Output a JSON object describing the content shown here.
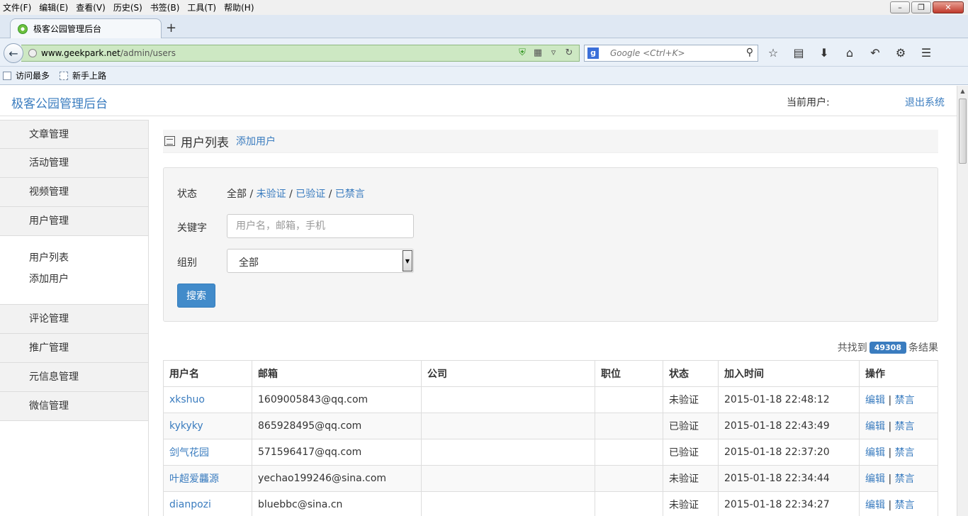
{
  "browser": {
    "menu": [
      "文件(F)",
      "编辑(E)",
      "查看(V)",
      "历史(S)",
      "书签(B)",
      "工具(T)",
      "帮助(H)"
    ],
    "tab_title": "极客公园管理后台",
    "url_domain": "www.geekpark.net",
    "url_path": "/admin/users",
    "search_placeholder": "Google <Ctrl+K>",
    "bookmarks": [
      "访问最多",
      "新手上路"
    ]
  },
  "header": {
    "brand": "极客公园管理后台",
    "current_user_label": "当前用户:",
    "logout": "退出系统"
  },
  "sidebar": {
    "groups_top": [
      "文章管理",
      "活动管理",
      "视频管理",
      "用户管理"
    ],
    "user_sub": [
      "用户列表",
      "添加用户"
    ],
    "groups_bottom": [
      "评论管理",
      "推广管理",
      "元信息管理",
      "微信管理"
    ]
  },
  "main": {
    "title": "用户列表",
    "add_link": "添加用户",
    "filter": {
      "status_label": "状态",
      "status_all": "全部",
      "status_unverified": "未验证",
      "status_verified": "已验证",
      "status_banned": "已禁言",
      "keyword_label": "关键字",
      "keyword_placeholder": "用户名，邮箱，手机",
      "group_label": "组别",
      "group_value": "全部",
      "search_button": "搜索"
    },
    "result": {
      "prefix": "共找到",
      "count": "49308",
      "suffix": "条结果"
    },
    "table": {
      "columns": [
        "用户名",
        "邮箱",
        "公司",
        "职位",
        "状态",
        "加入时间",
        "操作"
      ],
      "edit_label": "编辑",
      "ban_label": "禁言",
      "rows": [
        {
          "username": "xkshuo",
          "email": "1609005843@qq.com",
          "company": "",
          "position": "",
          "status": "未验证",
          "joined": "2015-01-18 22:48:12"
        },
        {
          "username": "kykyky",
          "email": "865928495@qq.com",
          "company": "",
          "position": "",
          "status": "已验证",
          "joined": "2015-01-18 22:43:49"
        },
        {
          "username": "剑气花园",
          "email": "571596417@qq.com",
          "company": "",
          "position": "",
          "status": "已验证",
          "joined": "2015-01-18 22:37:20"
        },
        {
          "username": "叶超爱龘源",
          "email": "yechao199246@sina.com",
          "company": "",
          "position": "",
          "status": "未验证",
          "joined": "2015-01-18 22:34:44"
        },
        {
          "username": "dianpozi",
          "email": "bluebbc@sina.cn",
          "company": "",
          "position": "",
          "status": "未验证",
          "joined": "2015-01-18 22:34:27"
        }
      ]
    }
  }
}
